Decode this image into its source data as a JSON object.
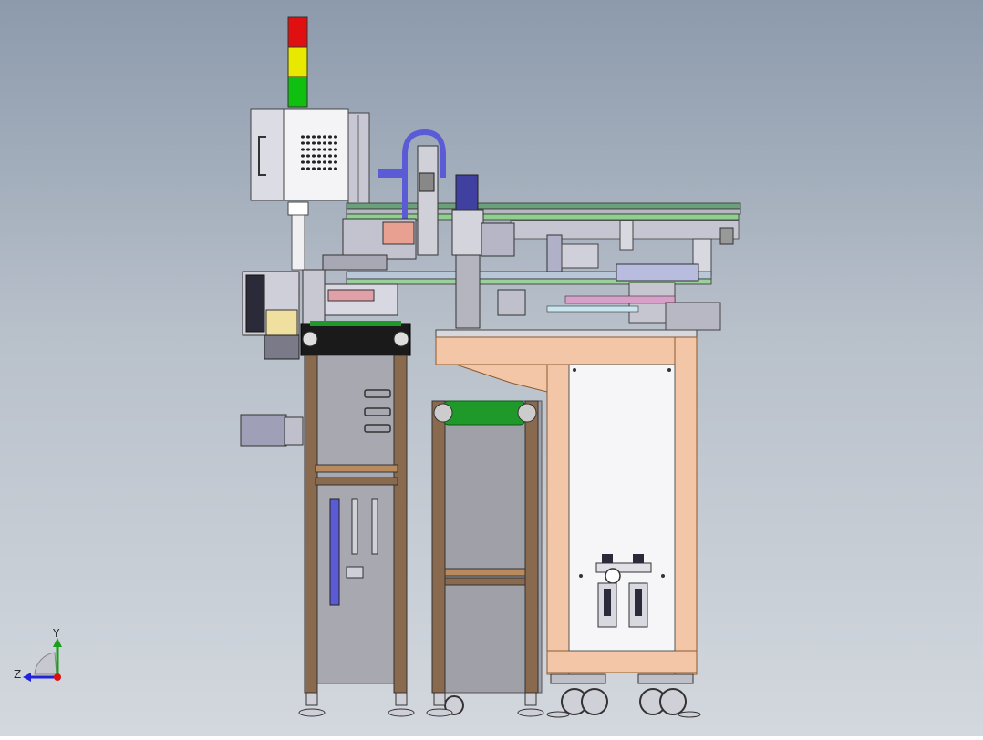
{
  "triad": {
    "y_label": "Y",
    "z_label": "Z"
  },
  "colors": {
    "frame_wood": "#f2c6a6",
    "frame_wood_dark": "#c98f5c",
    "extrusion": "#8a6a4e",
    "panel_gray": "#a9aab2",
    "panel_white": "#f6f6f8",
    "belt_green": "#1f9a2a",
    "tube_blue": "#6a6ad8",
    "signal_red": "#e01010",
    "signal_yellow": "#e8e800",
    "signal_green": "#10c010",
    "axis_y": "#19a019",
    "axis_z": "#2222dd",
    "axis_x": "#dd1111"
  },
  "components": [
    "signal-tower",
    "control-cabinet",
    "vent-slots",
    "gantry-beam",
    "vertical-z-axis",
    "blue-air-tube",
    "servo-motor",
    "belt-conveyor-upper",
    "belt-conveyor-lower",
    "support-frame-left",
    "support-frame-middle",
    "wooden-frame-cabinet",
    "access-panel",
    "air-filter-regulator",
    "caster-wheels",
    "leveling-feet"
  ]
}
